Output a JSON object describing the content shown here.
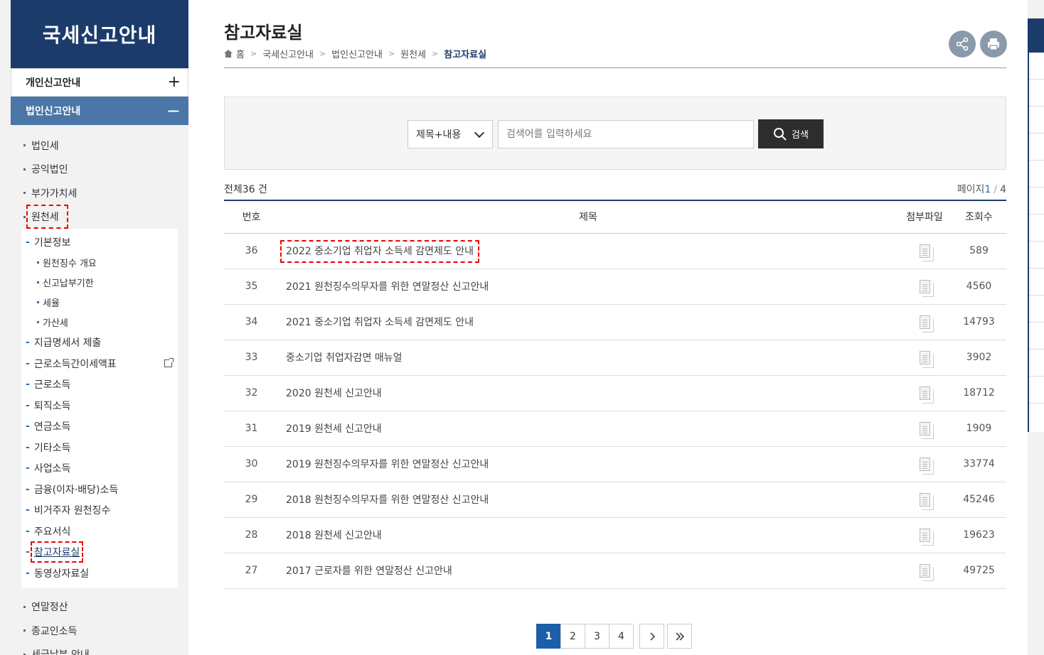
{
  "sidebar": {
    "title": "국세신고안내",
    "top_items": [
      {
        "label": "개인신고안내",
        "toggle": "+"
      },
      {
        "label": "법인신고안내",
        "toggle": "−"
      }
    ],
    "level1": [
      "법인세",
      "공익법인",
      "부가가치세",
      "원천세"
    ],
    "level2_before": [
      "기본정보"
    ],
    "level3": [
      "원천징수 개요",
      "신고납부기한",
      "세율",
      "가산세"
    ],
    "level2_after": [
      "지급명세서 제출",
      "근로소득간이세액표",
      "근로소득",
      "퇴직소득",
      "연금소득",
      "기타소득",
      "사업소득",
      "금융(이자·배당)소득",
      "비거주자 원천징수",
      "주요서식",
      "참고자료실",
      "동영상자료실"
    ],
    "level1_after": [
      "연말정산",
      "종교인소득",
      "세금납부 안내"
    ]
  },
  "header": {
    "title": "참고자료실",
    "breadcrumb": [
      "홈",
      "국세신고안내",
      "법인신고안내",
      "원천세",
      "참고자료실"
    ]
  },
  "search": {
    "select_value": "제목+내용",
    "placeholder": "검색어를 입력하세요",
    "button_label": "검색"
  },
  "summary": {
    "total_prefix": "전체",
    "total_count": "36",
    "total_suffix": " 건",
    "page_label": "페이지",
    "page_current": "1",
    "page_sep": "/",
    "page_total": "4"
  },
  "table": {
    "headers": {
      "no": "번호",
      "title": "제목",
      "file": "첨부파일",
      "views": "조회수"
    },
    "rows": [
      {
        "no": "36",
        "title": "2022 중소기업 취업자 소득세 감면제도 안내",
        "views": "589"
      },
      {
        "no": "35",
        "title": "2021 원천징수의무자를 위한 연말정산 신고안내",
        "views": "4560"
      },
      {
        "no": "34",
        "title": "2021 중소기업 취업자 소득세 감면제도 안내",
        "views": "14793"
      },
      {
        "no": "33",
        "title": "중소기업 취업자감면 매뉴얼",
        "views": "3902"
      },
      {
        "no": "32",
        "title": "2020 원천세 신고안내",
        "views": "18712"
      },
      {
        "no": "31",
        "title": "2019 원천세 신고안내",
        "views": "1909"
      },
      {
        "no": "30",
        "title": "2019 원천징수의무자를 위한 연말정산 신고안내",
        "views": "33774"
      },
      {
        "no": "29",
        "title": "2018 원천징수의무자를 위한 연말정산 신고안내",
        "views": "45246"
      },
      {
        "no": "28",
        "title": "2018 원천세 신고안내",
        "views": "19623"
      },
      {
        "no": "27",
        "title": "2017 근로자를 위한 연말정산 신고안내",
        "views": "49725"
      }
    ]
  },
  "pagination": {
    "pages": [
      "1",
      "2",
      "3",
      "4"
    ],
    "next": "›",
    "last": "»"
  },
  "colors": {
    "navy": "#1b3b6b",
    "active_menu": "#4a76a8",
    "page_active": "#1b5fa8",
    "highlight_dashed": "#e00000"
  }
}
